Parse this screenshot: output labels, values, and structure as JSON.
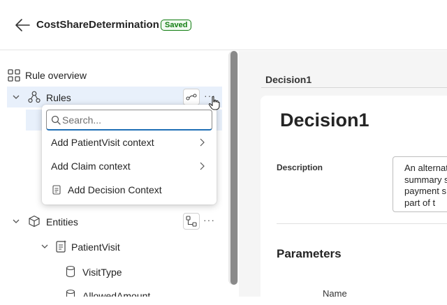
{
  "header": {
    "title": "CostShareDetermination",
    "status_badge": "Saved"
  },
  "tree": {
    "rule_overview": "Rule overview",
    "rules": "Rules",
    "entities": "Entities",
    "patient_visit": "PatientVisit",
    "visit_type": "VisitType",
    "allowed_amount": "AllowedAmount"
  },
  "menu": {
    "search_placeholder": "Search...",
    "items": [
      {
        "label": "Add PatientVisit context",
        "icon": "chevron-right-icon"
      },
      {
        "label": "Add Claim context",
        "icon": "chevron-right-icon"
      },
      {
        "label": "Add Decision Context",
        "icon": "document-icon"
      }
    ]
  },
  "panel": {
    "tab": "Decision1",
    "title": "Decision1",
    "description_label": "Description",
    "description_text": "An alternative summary s payment s a part of t",
    "parameters_heading": "Parameters",
    "name_column": "Name"
  },
  "colors": {
    "accent": "#1f6fb5",
    "selected_bg": "#e8f0fb",
    "saved_green": "#107c10"
  }
}
